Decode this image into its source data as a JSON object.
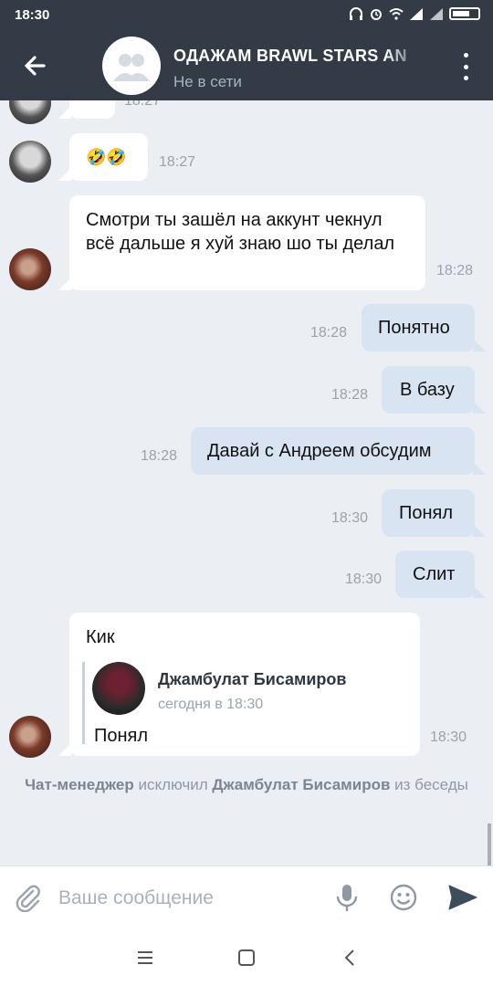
{
  "status_bar": {
    "time": "18:30"
  },
  "header": {
    "title": "ОДАЖАМ BRAWL STARS AN",
    "subtitle": "Не в сети"
  },
  "messages": [
    {
      "dir": "in",
      "text": "🤣🤣",
      "time": "18:27"
    },
    {
      "dir": "in",
      "text": "Смотри ты зашёл на аккунт чекнул всё дальше я хуй знаю шо ты делал",
      "time": "18:28"
    },
    {
      "dir": "out",
      "text": "Понятно",
      "time": "18:28"
    },
    {
      "dir": "out",
      "text": "В базу",
      "time": "18:28"
    },
    {
      "dir": "out",
      "text": "Давай с Андреем обсудим",
      "time": "18:28"
    },
    {
      "dir": "out",
      "text": "Понял",
      "time": "18:30"
    },
    {
      "dir": "out",
      "text": "Слит",
      "time": "18:30"
    },
    {
      "dir": "in",
      "text": "Кик",
      "time": "18:30",
      "forward": {
        "author": "Джамбулат Бисамиров",
        "date": "сегодня в 18:30",
        "text": "Понял"
      }
    }
  ],
  "partial_top_time": "18:27",
  "service_message": {
    "actor": "Чат-менеджер",
    "action": "исключил",
    "target": "Джамбулат Бисамиров",
    "suffix": "из беседы"
  },
  "composer": {
    "placeholder": "Ваше сообщение"
  }
}
